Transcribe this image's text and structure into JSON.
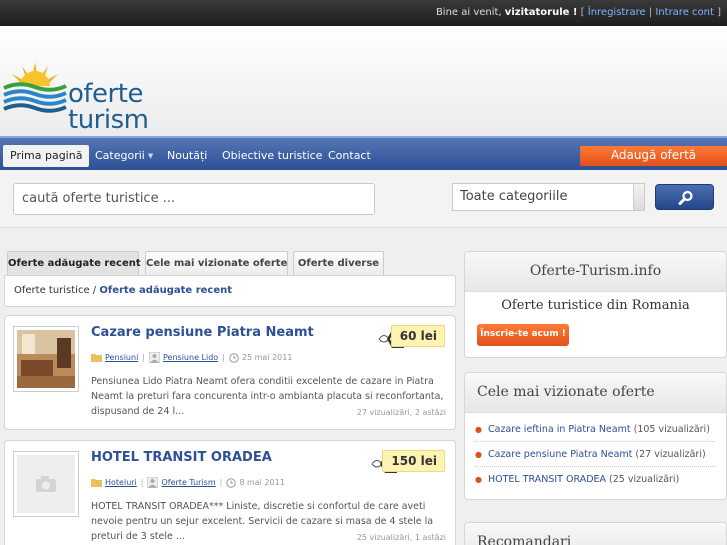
{
  "topbar": {
    "welcome": "Bine ai venit, ",
    "user": "vizitatorule !",
    "open_bracket": " [ ",
    "register": "Înregistrare",
    "sep": " | ",
    "login": "Intrare cont",
    "close_bracket": " ]"
  },
  "logo": {
    "line1": "oferte",
    "line2": "turism"
  },
  "nav": {
    "items": [
      "Prima pagină",
      "Categorii",
      "Noutăți",
      "Obiective turistice",
      "Contact"
    ],
    "caret": "▼",
    "add_offer": "Adaugă ofertă"
  },
  "search": {
    "placeholder": "caută oferte turistice ...",
    "category": "Toate categoriile"
  },
  "tabs": [
    "Oferte adăugate recent",
    "Cele mai vizionate oferte",
    "Oferte diverse"
  ],
  "breadcrumb": {
    "root": "Oferte turistice",
    "sep": " / ",
    "current": "Oferte adăugate recent"
  },
  "listings": [
    {
      "title": "Cazare pensiune Piatra Neamt",
      "price": "60 lei",
      "category": "Pensiuni",
      "author": "Pensiune Lido",
      "date": "25 mai 2011",
      "description": "Pensiunea Lido Piatra Neamt ofera conditii excelente de cazare in Piatra Neamt la preturi fara concurenta intr-o ambianta placuta si reconfortanta, dispusand de 24 l...",
      "stats": "27 vizualizări, 2 astăzi"
    },
    {
      "title": "HOTEL TRANSIT ORADEA",
      "price": "150 lei",
      "category": "Hoteluri",
      "author": "Oferte Turism",
      "date": "8 mai 2011",
      "description": "HOTEL TRANSIT ORADEA*** Liniste, discretie si confortul de care aveti nevoie pentru un sejur excelent. Servicii de cazare si masa de 4 stele la preturi de 3 stele ...",
      "stats": "25 vizualizări, 1 astăzi"
    }
  ],
  "sidebar": {
    "site_title": "Oferte-Turism.info",
    "tagline": "Oferte turistice din Romania",
    "signup": "Înscrie-te acum !",
    "popular_title": "Cele mai vizionate oferte",
    "popular": [
      {
        "title": "Cazare ieftina in Piatra Neamt",
        "views": " (105 vizualizări)"
      },
      {
        "title": "Cazare pensiune Piatra Neamt",
        "views": " (27 vizualizări)"
      },
      {
        "title": "HOTEL TRANSIT ORADEA",
        "views": " (25 vizualizări)"
      }
    ],
    "recommend_title": "Recomandari"
  },
  "colors": {
    "accent": "#e2501a",
    "nav": "#2d5096",
    "link": "#2d5096",
    "price_bg": "#fff3b3"
  }
}
